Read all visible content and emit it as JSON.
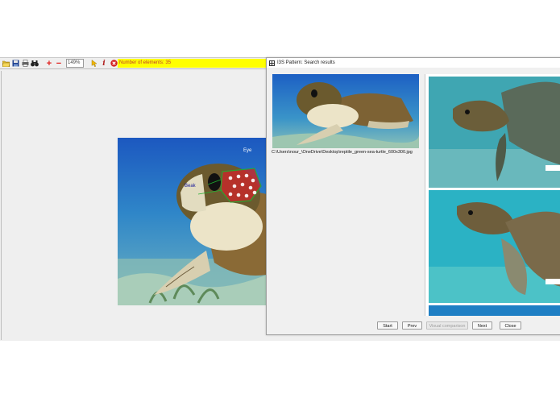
{
  "toolbar": {
    "buttons": [
      {
        "name": "open-folder-icon",
        "glyph": "📂",
        "color": "#c8a000"
      },
      {
        "name": "save-icon",
        "glyph": "💾",
        "color": "#1d3f8f"
      },
      {
        "name": "print-icon",
        "glyph": "🖶",
        "color": "#333333"
      },
      {
        "name": "binoculars-icon",
        "glyph": "👓",
        "color": "#222222"
      },
      {
        "name": "zoom-in-icon",
        "glyph": "+",
        "color": "#e0201e"
      },
      {
        "name": "zoom-out-icon",
        "glyph": "−",
        "color": "#e0201e"
      }
    ],
    "zoom_value": "149%",
    "tools": [
      {
        "name": "pointer-icon",
        "glyph": "➤",
        "color": "#e8a500"
      },
      {
        "name": "info-icon",
        "glyph": "i",
        "color": "#b02020"
      },
      {
        "name": "stop-icon",
        "glyph": "✖",
        "color": "#d42020"
      },
      {
        "name": "alert-icon",
        "glyph": "!",
        "color": "#e0a000"
      }
    ],
    "element_count_text": "Number of elements: 35",
    "element_count_bg": "#ffff00"
  },
  "main_image": {
    "labels": [
      "Beak",
      "Eye"
    ]
  },
  "dialog": {
    "title": "I3S Pattern: Search results",
    "title_icon": "i3s-pattern-icon",
    "query_path": "C:\\Users\\nour_\\OneDrive\\Desktop\\reptile_green-sea-turtle_600x300.jpg",
    "buttons": {
      "start": "Start",
      "prev": "Prev",
      "visual": "Visual comparison",
      "next": "Next",
      "close": "Close"
    }
  },
  "colors": {
    "water_top": "#1f5fc4",
    "water_mid": "#2f8cc8",
    "water_teal": "#2ea5b5",
    "sand": "#b9d6c6",
    "turtle_shell": "#7a5a2a",
    "turtle_skin": "#e8e0c4",
    "annotation_red": "#d42020",
    "annotation_green": "#20b030"
  }
}
